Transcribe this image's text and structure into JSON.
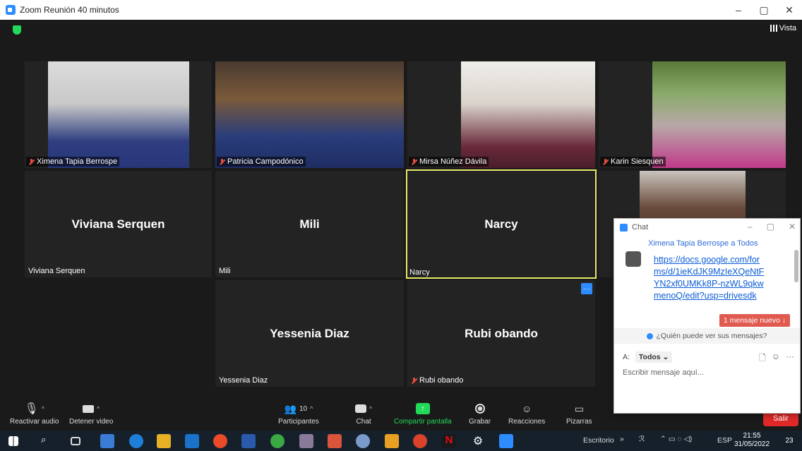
{
  "window": {
    "title": "Zoom Reunión 40 minutos",
    "min": "–",
    "max": "▢",
    "close": "✕"
  },
  "view_label": "Vista",
  "tiles": [
    {
      "name": "Ximena Tapia Berrospe"
    },
    {
      "name": "Patricia Campodónico"
    },
    {
      "name": "Mirsa Núñez Dávila"
    },
    {
      "name": "Karin Siesquen"
    },
    {
      "name": "Viviana Serquen",
      "big": "Viviana Serquen"
    },
    {
      "name": "Mili",
      "big": "Mili"
    },
    {
      "name": "Narcy",
      "big": "Narcy"
    },
    {
      "name": "Yessenia Diaz",
      "big": "Yessenia Diaz"
    },
    {
      "name": "Rubi obando",
      "big": "Rubi obando"
    }
  ],
  "toolbar": {
    "audio": "Reactivar audio",
    "video": "Detener video",
    "participants": "Participantes",
    "participants_count": "10",
    "chat": "Chat",
    "share": "Compartir pantalla",
    "record": "Grabar",
    "reactions": "Reacciones",
    "whiteboards": "Pizarras",
    "leave": "Salir"
  },
  "chat": {
    "title": "Chat",
    "sender": "Ximena Tapia Berrospe a Todos",
    "message": "https://docs.google.com/forms/d/1ieKdJK9MzIeXQeNtFYN2xf0UMKk8P-nzWL9qkwmenoQ/edit?usp=drivesdk",
    "new_message": "1 mensaje nuevo ↓",
    "who_can_see": "¿Quién puede ver sus mensajes?",
    "to_label": "A:",
    "to_value": "Todos ⌄",
    "placeholder": "Escribir mensaje aquí..."
  },
  "taskbar": {
    "desktop": "Escritorio",
    "lang": "ESP",
    "time": "21:55",
    "date": "31/05/2022",
    "notifications": "23"
  }
}
